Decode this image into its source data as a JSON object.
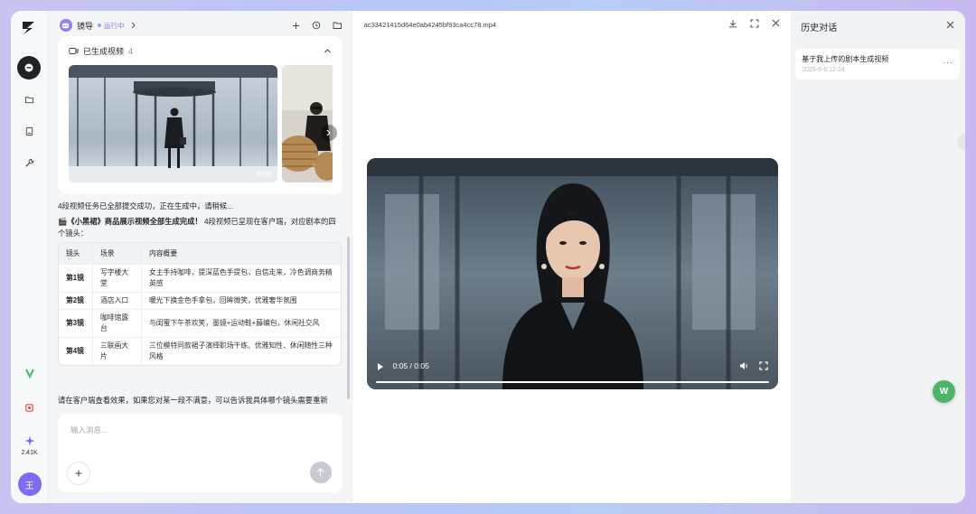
{
  "sidebar": {
    "nav": [
      "chat-icon",
      "folder-icon",
      "book-icon",
      "tool-icon"
    ],
    "usage": "2.41K",
    "user_initial": "王"
  },
  "chat": {
    "agent_name": "镜导",
    "status": "运行中",
    "generated": {
      "title": "已生成视频",
      "count": "4",
      "durations": [
        "00:05"
      ]
    },
    "msg1": "4段视频任务已全部提交成功，正在生成中，请稍候...",
    "msg2_icon": "🎬",
    "msg2_bold": "《小黑裙》商品展示视频全部生成完成！",
    "msg2_rest": " 4段视频已呈现在客户端，对应剧本的四个镜头：",
    "table": {
      "headers": [
        "镜头",
        "场景",
        "内容概要"
      ],
      "rows": [
        [
          "第1镜",
          "写字楼大堂",
          "女主手持咖啡，提深蓝色手提包，自信走来，冷色调商务精英感"
        ],
        [
          "第2镜",
          "酒店入口",
          "暖光下换金色手拿包，回眸微笑，优雅奢华氛围"
        ],
        [
          "第3镜",
          "咖啡馆露台",
          "与闺蜜下午茶欢笑，墨镜+运动鞋+藤编包，休闲社交风"
        ],
        [
          "第4镜",
          "三联画大片",
          "三位模特同款裙子演绎职场干练、优雅知性、休闲随性三种风格"
        ]
      ]
    },
    "msg3": "请在客户端查看效果，如果您对某一段不满意，可以告诉我具体哪个镜头需要重新",
    "input_placeholder": "输入消息..."
  },
  "preview": {
    "file_name": "ac33421415d64e0ab4245bf93ca4cc78.mp4",
    "time": "0:05 / 0:05",
    "progress": 1.0
  },
  "history": {
    "title": "历史对话",
    "items": [
      {
        "title": "基于我上传的剧本生成视频",
        "time": "2026-6-8 12:24"
      }
    ]
  },
  "floating_badge": "W",
  "colors": {
    "accent": "#7b6cf2",
    "status": "#7a7ff0",
    "fab": "#4db56a"
  }
}
